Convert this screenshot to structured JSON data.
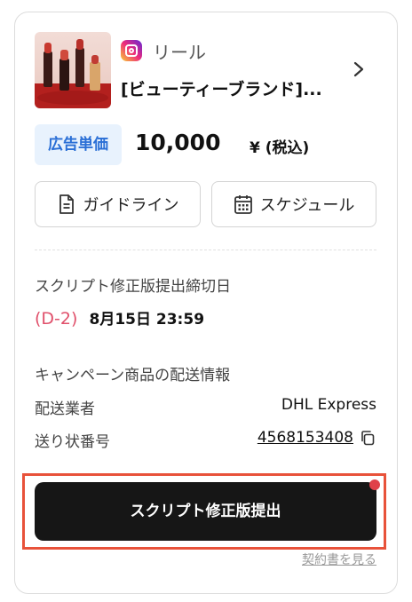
{
  "campaign": {
    "platform_label": "リール",
    "platform_icon": "instagram-icon",
    "title": "[ビューティーブランド]..."
  },
  "price": {
    "badge_label": "広告単価",
    "value": "10,000",
    "unit": "¥ (税込)"
  },
  "actions": {
    "guideline_label": "ガイドライン",
    "schedule_label": "スケジュール"
  },
  "deadline": {
    "label": "スクリプト修正版提出締切日",
    "d_count": "(D-2)",
    "date": "8月15日 23:59"
  },
  "shipping": {
    "section_label": "キャンペーン商品の配送情報",
    "carrier_key": "配送業者",
    "carrier_value": "DHL Express",
    "tracking_key": "送り状番号",
    "tracking_value": "4568153408"
  },
  "submit_button_label": "スクリプト修正版提出",
  "contract_link_label": "契約書を見る",
  "colors": {
    "accent_blue": "#2a6fd6",
    "badge_bg": "#e8f2fd",
    "d_count": "#e0506b",
    "primary_button": "#161616",
    "highlight": "#e8523a",
    "notify_dot": "#e0414a"
  }
}
